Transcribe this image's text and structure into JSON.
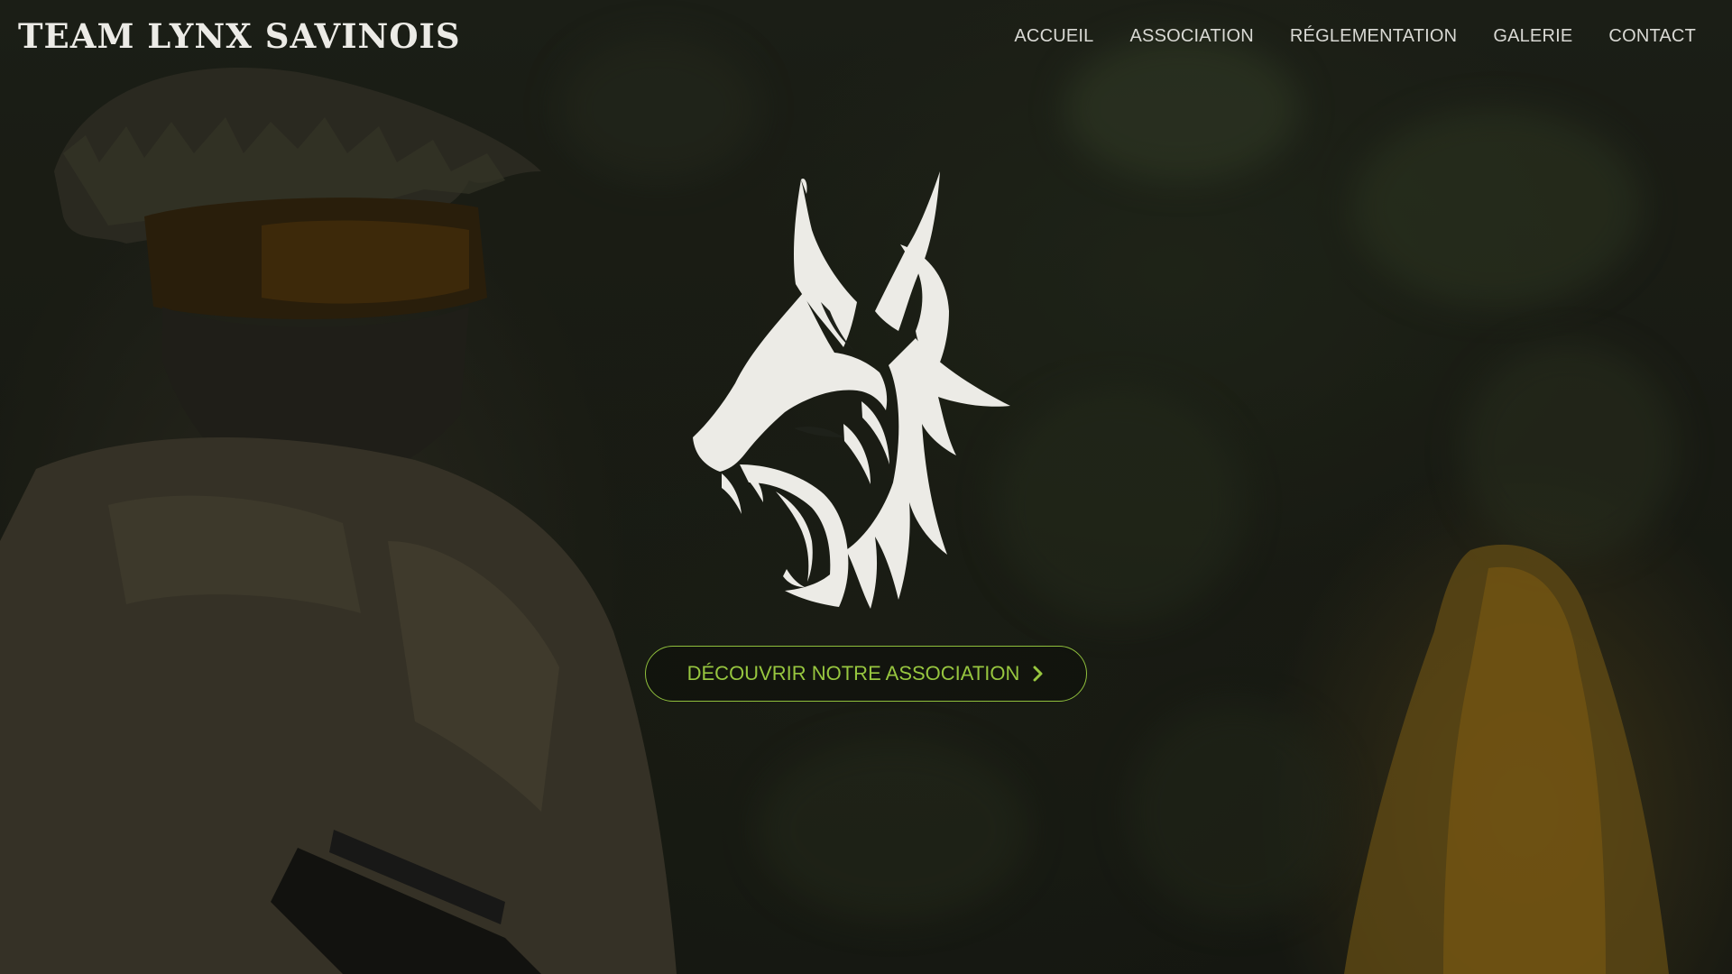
{
  "brand": {
    "name": "TEAM LYNX SAVINOIS"
  },
  "nav": {
    "items": [
      {
        "label": "ACCUEIL"
      },
      {
        "label": "ASSOCIATION"
      },
      {
        "label": "RÉGLEMENTATION"
      },
      {
        "label": "GALERIE"
      },
      {
        "label": "CONTACT"
      }
    ]
  },
  "hero": {
    "logo_icon": "lynx-head-icon",
    "cta_label": "DÉCOUVRIR NOTRE ASSOCIATION",
    "cta_icon": "chevron-right-icon"
  },
  "colors": {
    "accent": "#8fbf3c",
    "text_light": "#ecebe6",
    "background": "#1c1f17"
  }
}
